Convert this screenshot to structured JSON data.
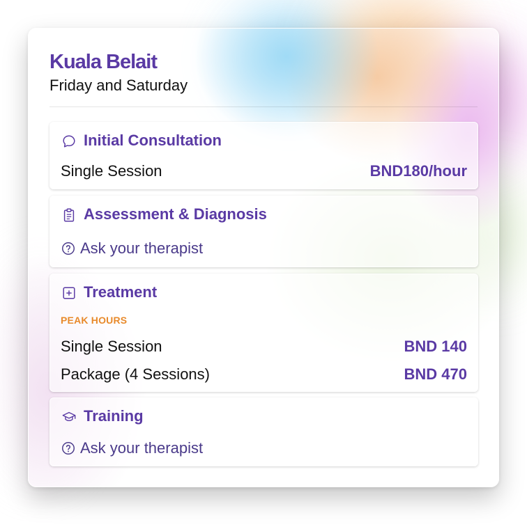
{
  "location": {
    "title": "Kuala Belait",
    "subtitle": "Friday and Saturday"
  },
  "sections": [
    {
      "title": "Initial Consultation",
      "icon": "chat-bubble-icon",
      "rows": [
        {
          "label": "Single Session",
          "price": "BND180/hour"
        }
      ]
    },
    {
      "title": "Assessment & Diagnosis",
      "icon": "clipboard-icon",
      "note": "Ask your therapist",
      "note_icon": "question-circle-icon"
    },
    {
      "title": "Treatment",
      "icon": "plus-square-icon",
      "tag": "PEAK HOURS",
      "rows": [
        {
          "label": "Single Session",
          "price": "BND 140"
        },
        {
          "label": "Package (4 Sessions)",
          "price": "BND 470"
        }
      ]
    },
    {
      "title": "Training",
      "icon": "graduation-cap-icon",
      "note": "Ask your therapist",
      "note_icon": "question-circle-icon"
    }
  ],
  "colors": {
    "accent": "#5a3aa4",
    "peak_tag": "#e88a2b",
    "text": "#111111"
  }
}
